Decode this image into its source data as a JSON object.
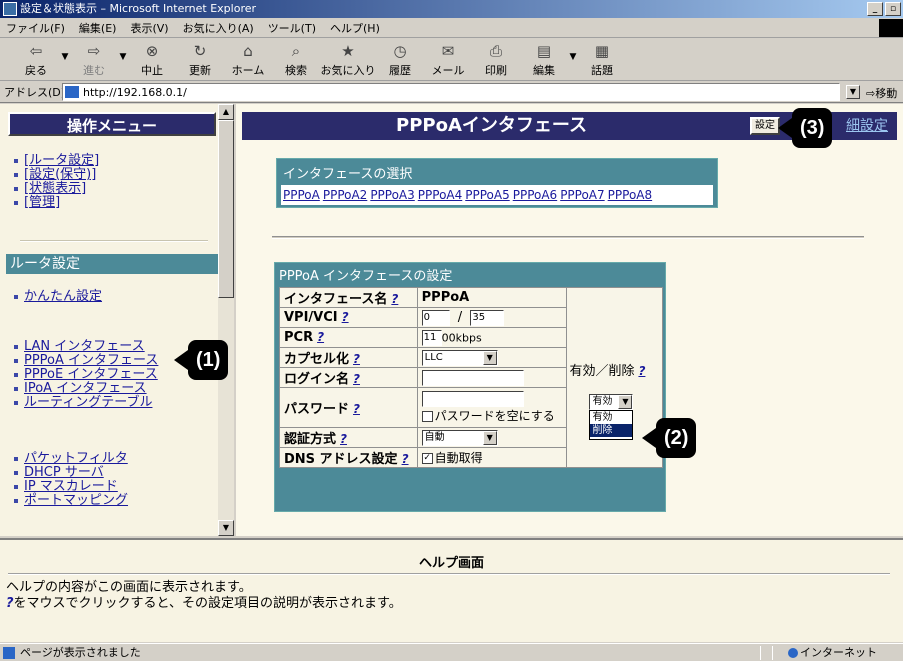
{
  "window": {
    "title": "設定＆状態表示 – Microsoft Internet Explorer"
  },
  "menu": [
    "ファイル(F)",
    "編集(E)",
    "表示(V)",
    "お気に入り(A)",
    "ツール(T)",
    "ヘルプ(H)"
  ],
  "toolbar": {
    "back": "戻る",
    "forward": "進む",
    "stop": "中止",
    "refresh": "更新",
    "home": "ホーム",
    "search": "検索",
    "favorites": "お気に入り",
    "history": "履歴",
    "mail": "メール",
    "print": "印刷",
    "edit": "編集",
    "discuss": "話題"
  },
  "address": {
    "label": "アドレス(D)",
    "url": "http://192.168.0.1/",
    "go": "移動"
  },
  "left": {
    "header": "操作メニュー",
    "top_links": [
      "[ルータ設定]",
      "[設定(保守)]",
      "[状態表示]",
      "[管理]"
    ],
    "section": "ルータ設定",
    "group1": [
      "かんたん設定"
    ],
    "group2": [
      "LAN インタフェース",
      "PPPoA インタフェース",
      "PPPoE インタフェース",
      "IPoA インタフェース",
      "ルーティングテーブル"
    ],
    "group3": [
      "パケットフィルタ",
      "DHCP サーバ",
      "IP マスカレード",
      "ポートマッピング"
    ]
  },
  "main": {
    "title": "PPPoAインタフェース",
    "settei_button": "設定",
    "detail_link": "細設定",
    "if_select_caption": "インタフェースの選択",
    "if_links": [
      "PPPoA",
      "PPPoA2",
      "PPPoA3",
      "PPPoA4",
      "PPPoA5",
      "PPPoA6",
      "PPPoA7",
      "PPPoA8"
    ],
    "config_caption": "PPPoA インタフェースの設定",
    "help_q": "?",
    "rows": {
      "ifname_label": "インタフェース名",
      "ifname_value": "PPPoA",
      "vpivci_label": "VPI/VCI",
      "vpi": "0",
      "slash": "/",
      "vci": "35",
      "pcr_label": "PCR",
      "pcr": "11",
      "pcr_unit": "00kbps",
      "encap_label": "カプセル化",
      "encap": "LLC",
      "login_label": "ログイン名",
      "password_label": "パスワード",
      "empty_password": "パスワードを空にする",
      "auth_label": "認証方式",
      "auth": "自動",
      "dns_label": "DNS アドレス設定",
      "dns_auto": "自動取得"
    },
    "enable_delete_label": "有効／削除",
    "enable_select": "有効",
    "dropdown_options": [
      "有効",
      "削除"
    ],
    "dropdown_highlighted": "削除"
  },
  "callouts": {
    "c1": "(1)",
    "c2": "(2)",
    "c3": "(3)"
  },
  "help": {
    "title": "ヘルプ画面",
    "line1": "ヘルプの内容がこの画面に表示されます。",
    "q": "?",
    "line2": "をマウスでクリックすると、その設定項目の説明が表示されます。"
  },
  "status": {
    "left": "ページが表示されました",
    "zone": "インターネット"
  }
}
